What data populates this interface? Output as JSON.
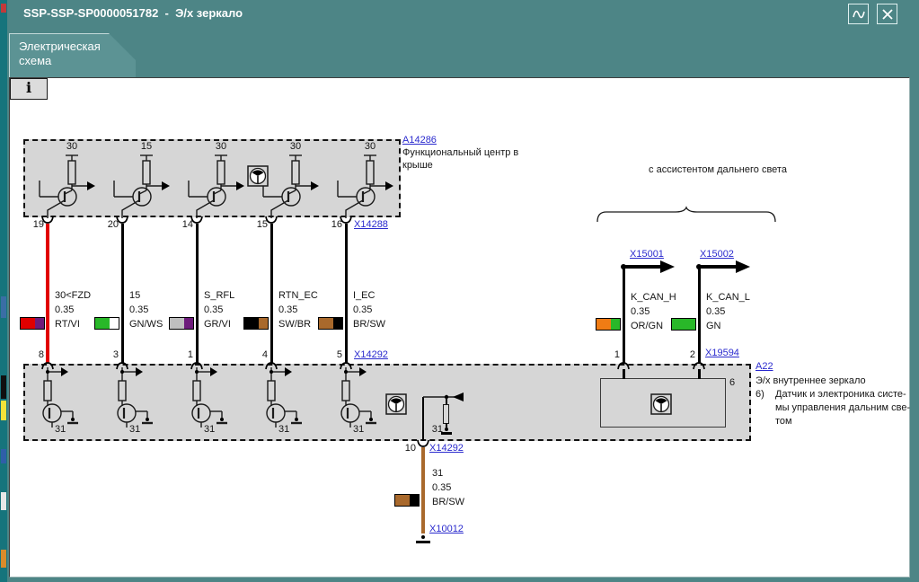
{
  "window": {
    "title": "SSP-SSP-SP0000051782  -  Э/х зеркало"
  },
  "tab": {
    "line1": "Электрическая",
    "line2": "схема"
  },
  "info_button_label": "i",
  "top_module": {
    "id": "A14286",
    "desc_line1": "Функциональный центр в",
    "desc_line2": "крыше",
    "connector_right": "X14288",
    "fuses": [
      "30",
      "15",
      "30",
      "30",
      "30"
    ],
    "pins_out": [
      "19",
      "20",
      "14",
      "15",
      "16"
    ]
  },
  "harness": {
    "connector_mid": "X14292",
    "wires": [
      {
        "signal": "30<FZD",
        "gauge": "0.35",
        "code": "RT/VI",
        "pin_top": "19",
        "pin_bottom": "8",
        "wire_color": "#e10000",
        "color_main": "#e10000",
        "color_stripe": "#6d1b7b"
      },
      {
        "signal": "15",
        "gauge": "0.35",
        "code": "GN/WS",
        "pin_top": "20",
        "pin_bottom": "3",
        "wire_color": "#000000",
        "color_main": "#29b829",
        "color_stripe": "#ffffff"
      },
      {
        "signal": "S_RFL",
        "gauge": "0.35",
        "code": "GR/VI",
        "pin_top": "14",
        "pin_bottom": "1",
        "wire_color": "#000000",
        "color_main": "#bfbfbf",
        "color_stripe": "#6d1b7b"
      },
      {
        "signal": "RTN_EC",
        "gauge": "0.35",
        "code": "SW/BR",
        "pin_top": "15",
        "pin_bottom": "4",
        "wire_color": "#000000",
        "color_main": "#000000",
        "color_stripe": "#a9692c"
      },
      {
        "signal": "I_EC",
        "gauge": "0.35",
        "code": "BR/SW",
        "pin_top": "16",
        "pin_bottom": "5",
        "wire_color": "#000000",
        "color_main": "#a9692c",
        "color_stripe": "#000000"
      }
    ]
  },
  "can_section": {
    "caption": "с ассистентом дальнего света",
    "branches": [
      {
        "connector_top": "X15001",
        "signal": "K_CAN_H",
        "gauge": "0.35",
        "code": "OR/GN",
        "pin_bottom": "1",
        "color_main": "#f07c14",
        "color_stripe": "#29b829"
      },
      {
        "connector_top": "X15002",
        "signal": "K_CAN_L",
        "gauge": "0.35",
        "code": "GN",
        "pin_bottom": "2",
        "color_main": "#29b829",
        "color_stripe": "#29b829"
      }
    ],
    "connector_bottom": "X19594"
  },
  "bottom_module": {
    "id": "A22",
    "desc": "Э/х внутреннее зеркало",
    "note_ref": "6)",
    "note_line1": "Датчик и электроника систе-",
    "note_line2": "мы управления дальним све-",
    "note_line3": "том",
    "inner_box_ref": "6",
    "ground_label": "31"
  },
  "ground_wire": {
    "pin": "10",
    "connector_top": "X14292",
    "signal": "31",
    "gauge": "0.35",
    "code": "BR/SW",
    "wire_color": "#a9692c",
    "color_main": "#a9692c",
    "color_stripe": "#000000",
    "connector_end": "X10012"
  }
}
